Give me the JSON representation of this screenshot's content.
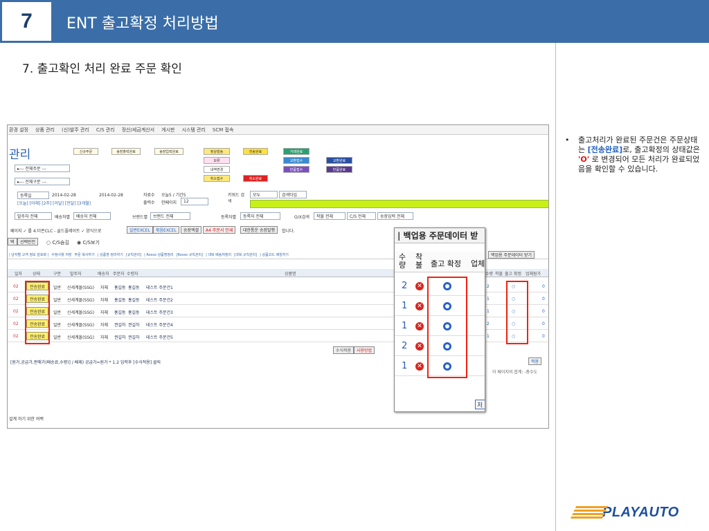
{
  "header": {
    "number": "7",
    "title": "ENT 출고확정 처리방법"
  },
  "subtitle": "7. 출고확인 처리 완료 주문 확인",
  "note": {
    "bullet": "•",
    "p1": "출고처리가 완료된 주문건은 주문상태는 ",
    "status_value": "[전송완료]",
    "p2": "로, 출고확정의 상태값은 ",
    "confirm_value": "'O'",
    "p3": " 로 변경되어 모든 처리가 완료되었음을 확인할 수 있습니다."
  },
  "logo": {
    "text": "PLAYAUTO"
  },
  "screenshot": {
    "menu": [
      "환경 설정",
      "상품 관리",
      "(신)발주 관리",
      "C/S 관리",
      "정산/세금계산서",
      "게시판",
      "시스템 관리",
      "SCM 접속"
    ],
    "page_title": "관리",
    "flow_boxes": [
      "신규주문",
      "송장출력완료",
      "송장입력완료",
      "정상발송",
      "보류",
      "내역변경",
      "취소접수",
      "전송완료",
      "취소완료",
      "거래완료",
      "교환접수",
      "반품접수",
      "교환완료",
      "반품완료"
    ],
    "filters": {
      "order_dropdown": "▸--- 전체주문 ---",
      "type_dropdown": "▸--- 전체구분 ---",
      "date_label": "등록일",
      "date_from": "2014-02-28",
      "date_to": "2014-02-28",
      "date_quick": "[오늘] [어제] [2주] [이달] [전달] [3개월]",
      "collect_label": "자료수",
      "collect_value": "오늘5 / 기간5",
      "output_label": "출력수",
      "per_page_label": "한페이지",
      "per_page_value": "12",
      "keyword_label": "키워드 검색",
      "keyword_value": "모두",
      "search_type": "검색타입",
      "orderer_filter": "발주처 전체",
      "shipper_label": "배송처별",
      "shipper_value": "배송처 전체",
      "brand_label": "브랜드별",
      "brand_value": "브랜드 전체",
      "reg_label": "등록자별",
      "reg_value": "등록자 전체",
      "or_search": "O/X검색",
      "cs_value": "착불 전체",
      "cs2_value": "C/S 전체",
      "invoice_value": "송장입력 전체"
    },
    "toolbar": [
      "일반EXCEL",
      "묶음EXCEL",
      "송장엑셀",
      "A4 주문서 인쇄",
      "대한통운 송장발행"
    ],
    "toolbar_prefix": "페이지 ✓ 를 4.더존CLC - 골드플레이트 ✓ 양식으로",
    "toolbar_suffix": "합니다.",
    "cs_row": {
      "btn1": "택",
      "btn2": "선택반전",
      "opt1": "C/S숨김",
      "opt2": "C/S보기"
    },
    "tabs": [
      "| 남자별 고객 정보 암호화 |",
      "수정사항 저장",
      "주문 복사하기",
      "| 상품명 정리하기",
      "[규칙관리]",
      "| Rosso 상품명정리",
      "[Rosso 규칙관리]",
      "| 대복 배송처정리",
      "[대복 규칙관리]",
      "| 상품코드 매칭하기"
    ],
    "tab_right": "백업용 주문데이터 받기",
    "columns": [
      "일자",
      "상태",
      "구분",
      "발주처",
      "배송처",
      "주문자",
      "수령자",
      "상품명"
    ],
    "right_cols": [
      "수량",
      "착불",
      "출고 확정",
      "업체원가"
    ],
    "rows": [
      {
        "date": "02",
        "status": "전송완료",
        "type": "일반",
        "orderer": "신세계몰(SSG)",
        "shipper": "자체",
        "buyer": "홍길동",
        "receiver": "홍길동",
        "product": "테스트 주문건1",
        "qty": "2",
        "cost": "0"
      },
      {
        "date": "02",
        "status": "전송완료",
        "type": "일반",
        "orderer": "신세계몰(SSG)",
        "shipper": "자체",
        "buyer": "홍길동",
        "receiver": "홍길동",
        "product": "테스트 주문건2",
        "qty": "1",
        "cost": "0"
      },
      {
        "date": "02",
        "status": "전송완료",
        "type": "일반",
        "orderer": "신세계몰(SSG)",
        "shipper": "자체",
        "buyer": "홍길동",
        "receiver": "홍길동",
        "product": "테스트 주문건3",
        "qty": "1",
        "cost": "0"
      },
      {
        "date": "02",
        "status": "전송완료",
        "type": "일반",
        "orderer": "신세계몰(SSG)",
        "shipper": "자체",
        "buyer": "권길하",
        "receiver": "권길하",
        "product": "테스트 주문건4",
        "qty": "2",
        "cost": "0"
      },
      {
        "date": "02",
        "status": "전송완료",
        "type": "일반",
        "orderer": "신세계몰(SSG)",
        "shipper": "자체",
        "buyer": "권길하",
        "receiver": "권길하",
        "product": "테스트 주문건5",
        "qty": "1",
        "cost": "0"
      }
    ],
    "footer": {
      "formula": "[원가,공급가,판매가(배송료,수량)] / 배제) 공급가=원가 * 1.2 입력후 [수식적용] 클릭",
      "btn_apply_formula": "수식적용",
      "btn_usage": "사용방법",
      "btn_apply": "적용",
      "page_total": "이 페이지의 합계: -총수도",
      "bottom_note": "설계 하기 위한 여백"
    },
    "zoom": {
      "title": "| 백업용 주문데이터 받",
      "h_qty": "수량",
      "h_cod": "착불",
      "h_confirm": "출고 확정",
      "h_cost": "업체",
      "qtys": [
        "2",
        "1",
        "1",
        "2",
        "1"
      ],
      "x_mark": "✕",
      "bottom_btn": "저"
    }
  }
}
